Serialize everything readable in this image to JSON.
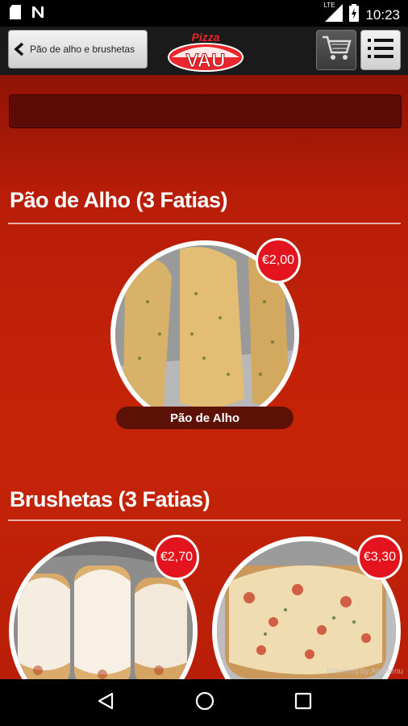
{
  "status_bar": {
    "time": "10:23",
    "network": "LTE",
    "icons": [
      "sd-card-icon",
      "notification-n-icon",
      "signal-icon",
      "battery-charging-icon"
    ]
  },
  "toolbar": {
    "back_label": "Pão de alho e brushetas",
    "logo_top": "Pizza",
    "logo_bottom": "VAU",
    "cart_icon": "cart-icon",
    "menu_icon": "list-menu-icon"
  },
  "sections": [
    {
      "title": "Pão de Alho (3 Fatias)",
      "products": [
        {
          "name": "Pão de Alho",
          "price": "€2,00"
        }
      ]
    },
    {
      "title": "Brushetas (3 Fatias)",
      "products": [
        {
          "name": "",
          "price": "€2,70"
        },
        {
          "name": "",
          "price": "€3,30"
        }
      ]
    }
  ],
  "footer": {
    "powered_by": "Powered by AmMenu"
  },
  "nav_bar": {
    "icons": [
      "back-triangle-icon",
      "home-circle-icon",
      "recents-square-icon"
    ]
  },
  "colors": {
    "background": "#c62408",
    "price_badge": "#e4141e",
    "search_bar": "#5c0c04"
  }
}
